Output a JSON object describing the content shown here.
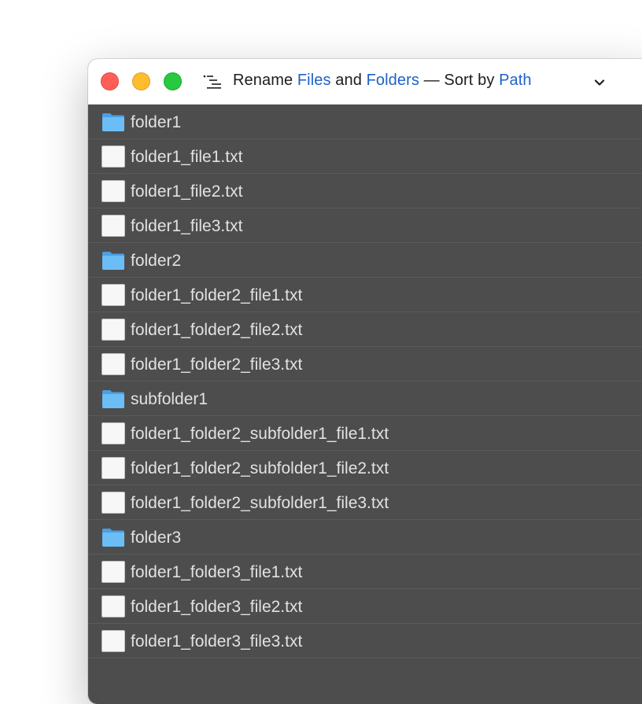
{
  "titlebar": {
    "title_parts": [
      "Rename ",
      "Files",
      " and ",
      "Folders",
      " — Sort by ",
      "Path"
    ],
    "list_icon": "list-icon",
    "menu_icon": "chevron-down-icon"
  },
  "colors": {
    "accent": "#1d62c8",
    "list_bg": "#4d4d4d",
    "text": "#e2e2e2",
    "folder": "#5ab0ef"
  },
  "items": [
    {
      "type": "folder",
      "name": "folder1"
    },
    {
      "type": "file",
      "name": "folder1_file1.txt"
    },
    {
      "type": "file",
      "name": "folder1_file2.txt"
    },
    {
      "type": "file",
      "name": "folder1_file3.txt"
    },
    {
      "type": "folder",
      "name": "folder2"
    },
    {
      "type": "file",
      "name": "folder1_folder2_file1.txt"
    },
    {
      "type": "file",
      "name": "folder1_folder2_file2.txt"
    },
    {
      "type": "file",
      "name": "folder1_folder2_file3.txt"
    },
    {
      "type": "folder",
      "name": "subfolder1"
    },
    {
      "type": "file",
      "name": "folder1_folder2_subfolder1_file1.txt"
    },
    {
      "type": "file",
      "name": "folder1_folder2_subfolder1_file2.txt"
    },
    {
      "type": "file",
      "name": "folder1_folder2_subfolder1_file3.txt"
    },
    {
      "type": "folder",
      "name": "folder3"
    },
    {
      "type": "file",
      "name": "folder1_folder3_file1.txt"
    },
    {
      "type": "file",
      "name": "folder1_folder3_file2.txt"
    },
    {
      "type": "file",
      "name": "folder1_folder3_file3.txt"
    }
  ]
}
